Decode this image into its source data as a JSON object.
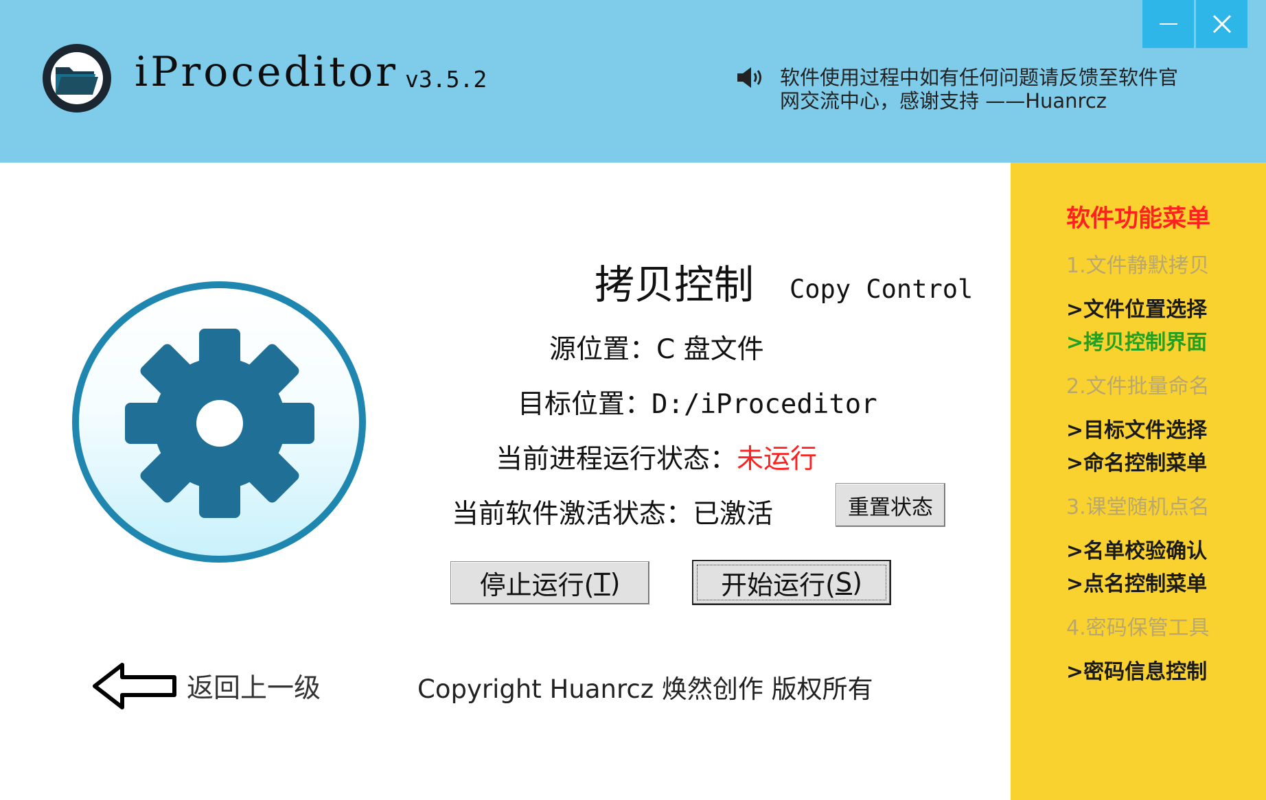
{
  "header": {
    "app_name": "iProceditor",
    "version": "v3.5.2",
    "notice": "软件使用过程中如有任何问题请反馈至软件官网交流中心，感谢支持 ——Huanrcz",
    "speaker_icon": "speaker-icon",
    "minimize_icon": "minimize-icon",
    "close_icon": "close-icon",
    "background_color": "#7fcbea",
    "window_button_color": "#2fb6e8"
  },
  "main": {
    "title": "拷贝控制",
    "title_en": "Copy Control",
    "source_label": "源位置：",
    "source_value": "C 盘文件",
    "target_label": "目标位置：",
    "target_value": "D:/iProceditor",
    "process_status_label": "当前进程运行状态：",
    "process_status_value": "未运行",
    "process_status_color": "#ff2020",
    "activation_label": "当前软件激活状态：",
    "activation_value": "已激活",
    "reset_button": "重置状态",
    "stop_button": "停止运行(",
    "stop_hotkey": "T",
    "start_button": "开始运行(",
    "start_hotkey": "S",
    "button_close_paren": ")",
    "gear_icon": "gear-icon"
  },
  "footer": {
    "back_label": "返回上一级",
    "back_icon": "left-arrow-icon",
    "copyright": "Copyright Huanrcz 焕然创作 版权所有"
  },
  "sidebar": {
    "title": "软件功能菜单",
    "background_color": "#fad22f",
    "items": [
      {
        "label": "1.文件静默拷贝",
        "kind": "section"
      },
      {
        "label": ">文件位置选择",
        "kind": "sub"
      },
      {
        "label": ">拷贝控制界面",
        "kind": "sub-active"
      },
      {
        "label": "2.文件批量命名",
        "kind": "section"
      },
      {
        "label": ">目标文件选择",
        "kind": "sub"
      },
      {
        "label": ">命名控制菜单",
        "kind": "sub"
      },
      {
        "label": "3.课堂随机点名",
        "kind": "section"
      },
      {
        "label": ">名单校验确认",
        "kind": "sub"
      },
      {
        "label": ">点名控制菜单",
        "kind": "sub"
      },
      {
        "label": "4.密码保管工具",
        "kind": "section"
      },
      {
        "label": ">密码信息控制",
        "kind": "sub"
      }
    ]
  }
}
